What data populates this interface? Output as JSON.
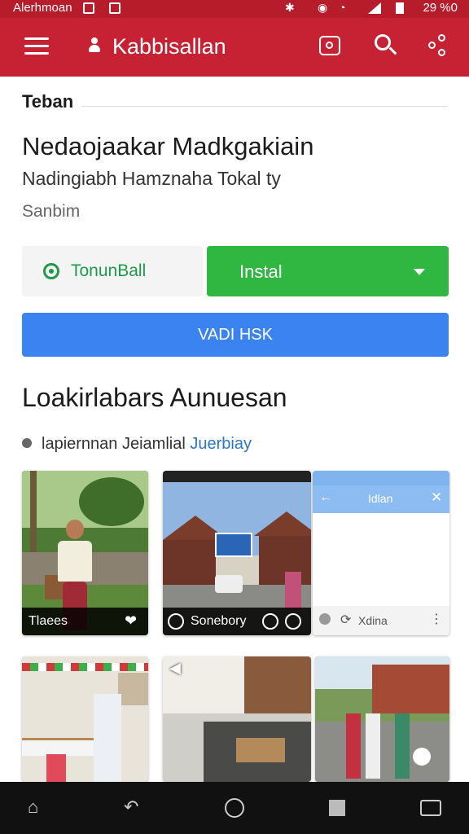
{
  "status_bar": {
    "left_text": "Alerhmoan",
    "right_text": "29 %0"
  },
  "app_bar": {
    "title": "Kabbisallan",
    "icons": [
      "menu-icon",
      "person-icon",
      "camera-icon",
      "search-icon",
      "share-icon"
    ]
  },
  "section_label": "Teban",
  "app": {
    "name": "Nedaojaakar Madkgakiain",
    "developer": "Nadingiabh Hamznaha Tokal ty",
    "category": "Sanbim"
  },
  "buttons": {
    "demo": "TonunBall",
    "install": "Instal",
    "wide": "VADI HSK"
  },
  "gallery": {
    "title": "Loakirlabars Aunuesan",
    "subtitle": "lapiernnan Jeiamlial",
    "subtitle_link": "Juerbiay",
    "tiles": [
      {
        "caption": "Tlaees",
        "thumb_icon": "heart-icon"
      },
      {
        "caption": "Sonebory",
        "thumb_icon": "play-icon"
      },
      {
        "header": "Idlan",
        "caption": "Xdina"
      }
    ]
  },
  "colors": {
    "app_bar": "#c62234",
    "install": "#2fb742",
    "wide_button": "#3a83f1",
    "link": "#2a76c9"
  }
}
